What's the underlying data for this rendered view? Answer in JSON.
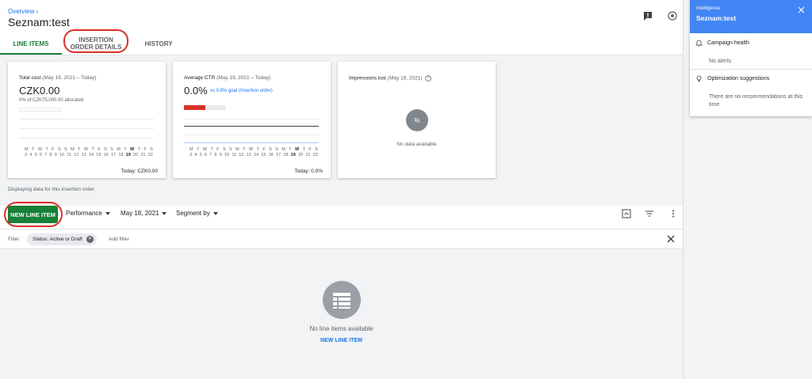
{
  "header": {
    "breadcrumb": "Overview ›",
    "title": "Seznam:test"
  },
  "tabs": [
    {
      "label": "LINE ITEMS",
      "active": true
    },
    {
      "label": "INSERTION ORDER DETAILS",
      "active": false
    },
    {
      "label": "HISTORY",
      "active": false
    }
  ],
  "cards": {
    "total_cost": {
      "label": "Total cost",
      "range": "(May 19, 2021 – Today)",
      "value": "CZK0.00",
      "sub": "0% of CZK75,000.00 allocated",
      "footer": "Today: CZK0.00"
    },
    "avg_ctr": {
      "label": "Average CTR",
      "range": "(May 19, 2021 – Today)",
      "value": "0.0%",
      "goal": "vs 0.8% goal (Insertion order)",
      "goal_progress": 0.5,
      "footer": "Today: 0.0%"
    },
    "impressions_lost": {
      "label": "Impressions lost",
      "range": "(May 18, 2021)",
      "badge": "%",
      "nodata": "No data available"
    },
    "weekdays": [
      "M",
      "T",
      "W",
      "T",
      "F",
      "S",
      "S",
      "M",
      "T",
      "W",
      "T",
      "F",
      "S",
      "S",
      "M",
      "T",
      "W",
      "T",
      "F",
      "S"
    ],
    "dates": [
      "3",
      "4",
      "5",
      "6",
      "7",
      "8",
      "9",
      "10",
      "11",
      "12",
      "13",
      "14",
      "15",
      "16",
      "17",
      "18",
      "19",
      "20",
      "21",
      "22"
    ]
  },
  "display_note": "Displaying data for this insertion order",
  "toolbar": {
    "new_line_item": "NEW LINE ITEM",
    "performance": "Performance",
    "date": "May 18, 2021",
    "segment_by": "Segment by"
  },
  "filter": {
    "label": "Filter",
    "chip": "Status: Active or Draft",
    "add": "Add filter"
  },
  "empty": {
    "text": "No line items available",
    "link": "NEW LINE ITEM"
  },
  "panel": {
    "kicker": "Intelligence",
    "title": "Seznam:test",
    "campaign_health": "Campaign health",
    "no_alerts": "No alerts",
    "optimization": "Optimization suggestions",
    "no_recs": "There are no recommendations at this time"
  },
  "colors": {
    "accent_green": "#188038",
    "link_blue": "#1a73e8",
    "panel_blue": "#4285f4",
    "highlight_red": "#d93025"
  }
}
